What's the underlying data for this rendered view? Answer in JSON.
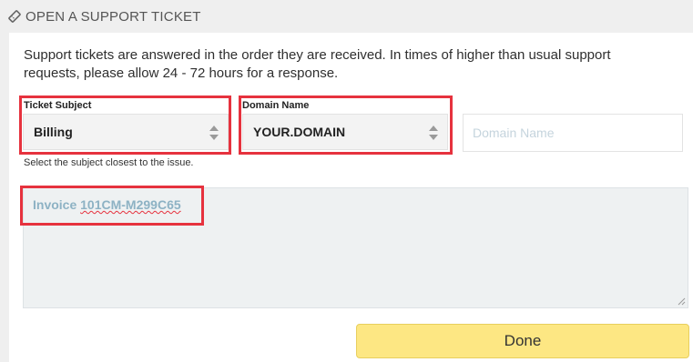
{
  "header": {
    "title": "OPEN A SUPPORT TICKET",
    "icon": "ticket-icon"
  },
  "intro": {
    "text": "Support tickets are answered in the order they are received. In times of higher than usual support requests, please allow 24 - 72 hours for a response."
  },
  "subject": {
    "label": "Ticket Subject",
    "value": "Billing"
  },
  "domain_select": {
    "label": "Domain Name",
    "value": "YOUR.DOMAIN"
  },
  "domain_input": {
    "placeholder": "Domain Name"
  },
  "hint": "Select the subject closest to the issue.",
  "message": {
    "prefix": "Invoice ",
    "spelled": "101CM-M299C65"
  },
  "done_button": {
    "label": "Done"
  },
  "colors": {
    "highlight": "#e6323e",
    "button": "#fde783"
  }
}
